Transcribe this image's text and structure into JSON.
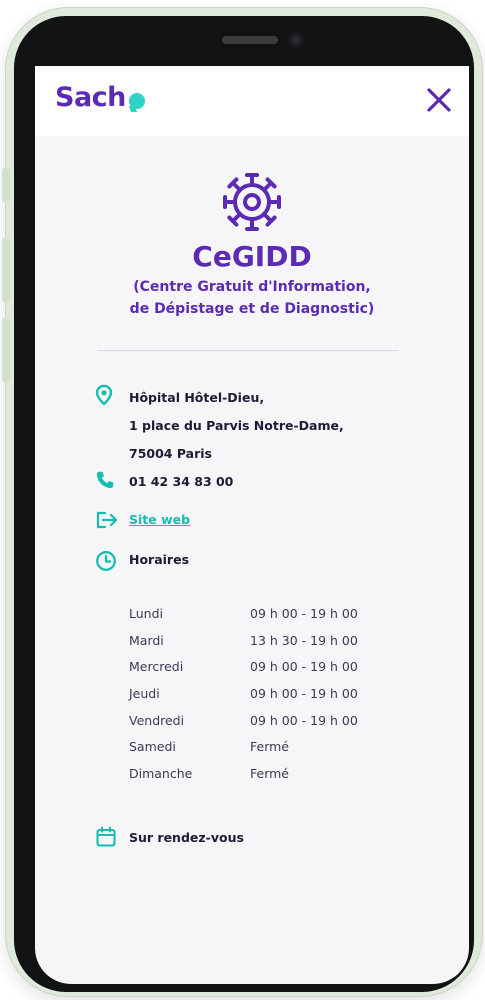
{
  "app": {
    "logo_text": "Sach",
    "close_icon": "close-icon"
  },
  "center": {
    "icon": "virus-icon",
    "title": "CeGIDD",
    "subtitle_line1": "(Centre Gratuit d'Information,",
    "subtitle_line2": "de Dépistage et de Diagnostic)"
  },
  "address": {
    "icon": "location-pin-icon",
    "line1": "Hôpital Hôtel-Dieu,",
    "line2": "1 place du Parvis Notre-Dame,",
    "line3": "75004 Paris"
  },
  "phone": {
    "icon": "phone-icon",
    "number": "01 42 34 83 00"
  },
  "website": {
    "icon": "external-link-icon",
    "label": "Site web"
  },
  "hours": {
    "icon": "clock-icon",
    "title": "Horaires",
    "days": [
      {
        "day": "Lundi",
        "time": "09 h 00 - 19 h 00"
      },
      {
        "day": "Mardi",
        "time": "13 h 30 - 19 h 00"
      },
      {
        "day": "Mercredi",
        "time": "09 h 00 - 19 h 00"
      },
      {
        "day": "Jeudi",
        "time": "09 h 00 - 19 h 00"
      },
      {
        "day": "Vendredi",
        "time": "09 h 00 - 19 h 00"
      },
      {
        "day": "Samedi",
        "time": "Fermé"
      },
      {
        "day": "Dimanche",
        "time": "Fermé"
      }
    ]
  },
  "appointment": {
    "icon": "calendar-icon",
    "label": "Sur rendez-vous"
  },
  "colors": {
    "brand_purple": "#5b2bb3",
    "accent_teal": "#2fd3c5",
    "link_teal": "#16bdb0",
    "screen_bg": "#f6f6f8"
  }
}
